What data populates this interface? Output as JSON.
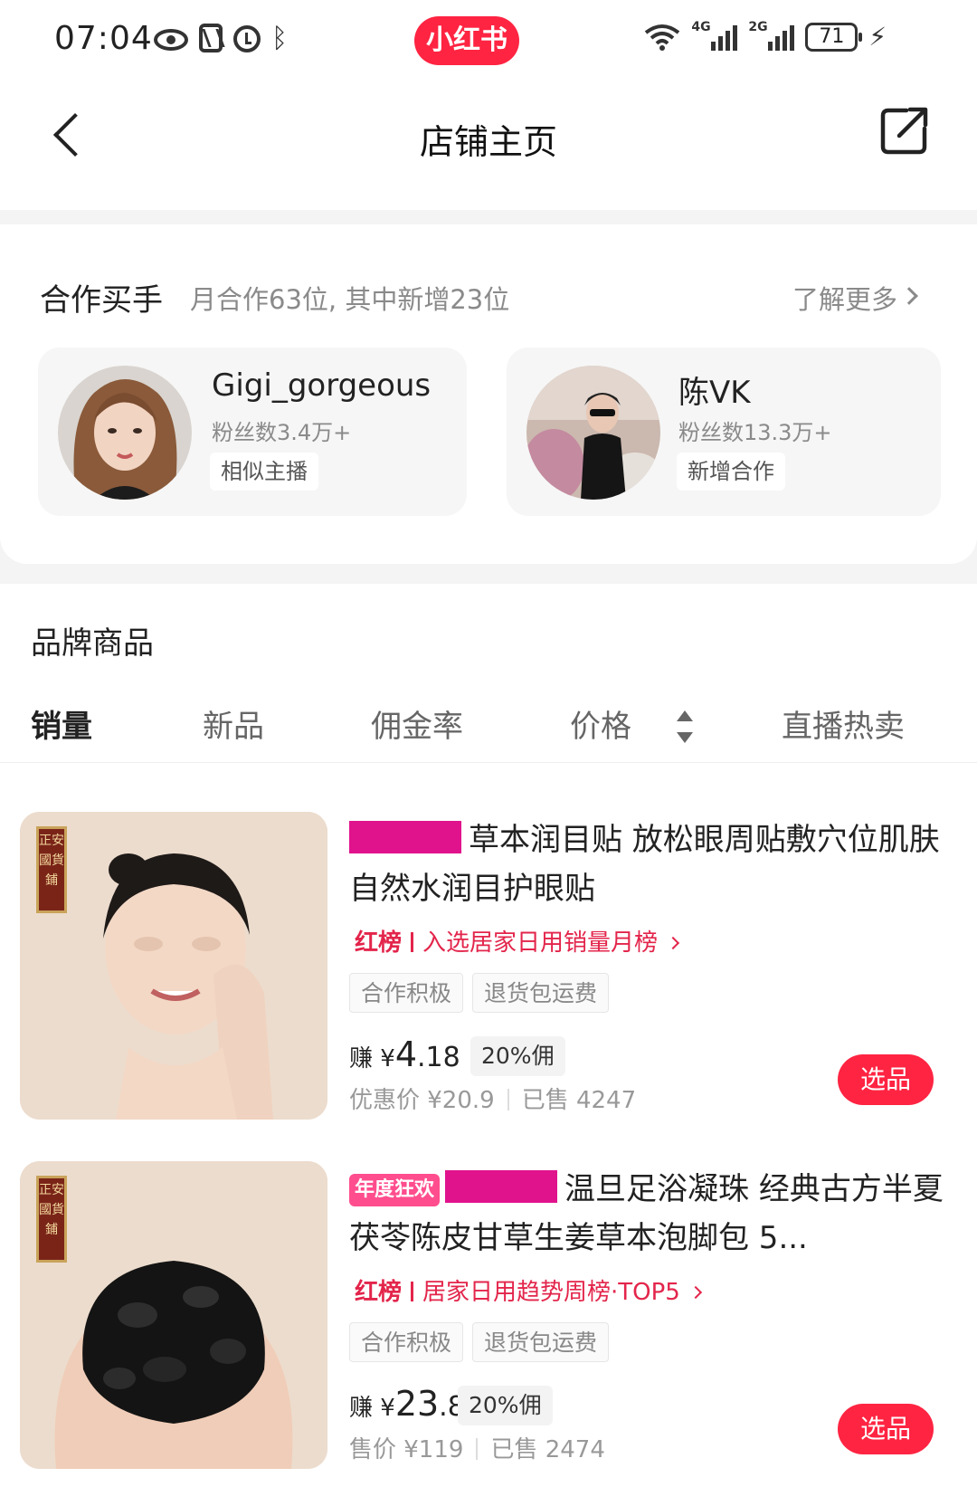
{
  "status_bar": {
    "time": "07:04",
    "app_badge": "小红书",
    "battery": "71",
    "sig1_label": "4G",
    "sig2_label": "2G"
  },
  "nav": {
    "title": "店铺主页"
  },
  "buyers": {
    "title": "合作买手",
    "subtitle": "月合作63位, 其中新增23位",
    "learn_more": "了解更多",
    "items": [
      {
        "name": "Gigi_gorgeous",
        "fans": "粉丝数3.4万+",
        "tag": "相似主播"
      },
      {
        "name": "陈VK",
        "fans": "粉丝数13.3万+",
        "tag": "新增合作"
      }
    ]
  },
  "products": {
    "section_title": "品牌商品",
    "sort_tabs": [
      "销量",
      "新品",
      "佣金率",
      "价格",
      "直播热卖"
    ],
    "items": [
      {
        "title": "草本润目贴 放松眼周贴敷穴位肌肤 自然水润目护眼贴",
        "rank_label": "红榜",
        "rank_text": "入选居家日用销量月榜",
        "tags": [
          "合作积极",
          "退货包运费"
        ],
        "earn_prefix": "赚 ¥",
        "earn_int": "4",
        "earn_dec": ".18",
        "commission": "20%佣",
        "price": "优惠价 ¥20.9",
        "sold": "已售 4247",
        "select": "选品",
        "seal": "正安國貨鋪"
      },
      {
        "year_tag": "年度狂欢",
        "title": "温旦足浴凝珠 经典古方半夏茯苓陈皮甘草生姜草本泡脚包 5...",
        "rank_label": "红榜",
        "rank_text": "居家日用趋势周榜·TOP5",
        "tags": [
          "合作积极",
          "退货包运费"
        ],
        "earn_prefix": "赚 ¥",
        "earn_int": "23",
        "earn_dec": ".8",
        "commission": "20%佣",
        "price": "售价 ¥119",
        "sold": "已售 2474",
        "select": "选品",
        "seal": "正安國貨鋪"
      }
    ]
  }
}
